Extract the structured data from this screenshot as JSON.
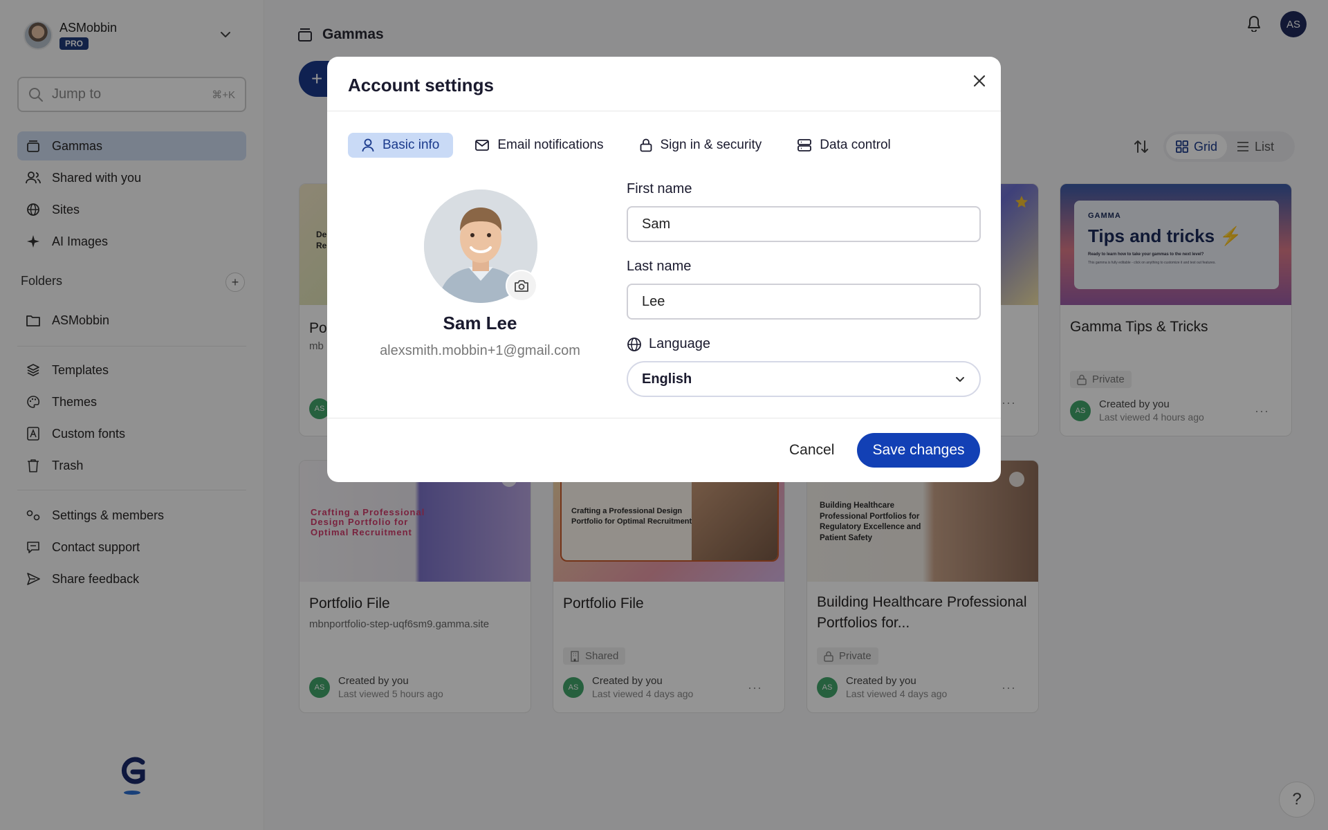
{
  "sidebar": {
    "user_name": "ASMobbin",
    "plan_badge": "PRO",
    "search": {
      "placeholder": "Jump to",
      "shortcut": "⌘+K"
    },
    "nav_primary": [
      {
        "label": "Gammas",
        "icon": "deck-icon",
        "active": true
      },
      {
        "label": "Shared with you",
        "icon": "users-icon"
      },
      {
        "label": "Sites",
        "icon": "globe-icon"
      },
      {
        "label": "AI Images",
        "icon": "sparkle-icon"
      }
    ],
    "folders_title": "Folders",
    "folders": [
      {
        "label": "ASMobbin",
        "icon": "folder-icon"
      }
    ],
    "nav_secondary": [
      {
        "label": "Templates",
        "icon": "layers-icon"
      },
      {
        "label": "Themes",
        "icon": "palette-icon"
      },
      {
        "label": "Custom fonts",
        "icon": "font-icon"
      },
      {
        "label": "Trash",
        "icon": "trash-icon"
      }
    ],
    "nav_tertiary": [
      {
        "label": "Settings & members",
        "icon": "settings-icon"
      },
      {
        "label": "Contact support",
        "icon": "chat-icon"
      },
      {
        "label": "Share feedback",
        "icon": "send-icon"
      }
    ]
  },
  "header": {
    "title": "Gammas",
    "avatar_initials": "AS",
    "view_toggle": {
      "grid": "Grid",
      "list": "List",
      "selected": "Grid"
    }
  },
  "cards": [
    {
      "title": "Po",
      "subtitle": "mb",
      "thumb_lines": [
        "De",
        "Re"
      ]
    },
    {
      "title": "",
      "subtitle": ""
    },
    {
      "title": "Gamma Tips & Tricks",
      "tag": "Private",
      "created": "Created by you",
      "viewed": "Last viewed 4 hours ago",
      "avatar": "AS",
      "thumb": {
        "brand": "GAMMA",
        "headline": "Tips and tricks ⚡",
        "line1": "Ready to learn how to take your gammas to the next level?",
        "line2": "This gamma is fully editable - click on anything to customize it and test out features."
      }
    },
    {
      "title": "Portfolio File",
      "subtitle": "mbnportfolio-step-uqf6sm9.gamma.site",
      "created": "Created by you",
      "viewed": "Last viewed 5 hours ago",
      "avatar": "AS",
      "thumb_text": "Crafting a Professional Design Portfolio for Optimal Recruitment"
    },
    {
      "title": "Portfolio File",
      "tag": "Shared",
      "created": "Created by you",
      "viewed": "Last viewed 4 days ago",
      "avatar": "AS",
      "thumb_text": "Crafting a Professional Design Portfolio for Optimal Recruitment"
    },
    {
      "title": "Building Healthcare Professional Portfolios for...",
      "tag": "Private",
      "created": "Created by you",
      "viewed": "Last viewed 4 days ago",
      "avatar": "AS",
      "thumb_text": "Building Healthcare Professional Portfolios for Regulatory Excellence and Patient Safety"
    }
  ],
  "card_menu_glyph": "···",
  "help_glyph": "?",
  "modal": {
    "title": "Account settings",
    "tabs": [
      {
        "label": "Basic info",
        "icon": "user-icon",
        "active": true
      },
      {
        "label": "Email notifications",
        "icon": "mail-icon"
      },
      {
        "label": "Sign in & security",
        "icon": "lock-icon"
      },
      {
        "label": "Data control",
        "icon": "database-icon"
      }
    ],
    "profile": {
      "name": "Sam Lee",
      "email": "alexsmith.mobbin+1@gmail.com"
    },
    "first_name": {
      "label": "First name",
      "value": "Sam"
    },
    "last_name": {
      "label": "Last name",
      "value": "Lee"
    },
    "language": {
      "label": "Language",
      "value": "English"
    },
    "cancel_label": "Cancel",
    "save_label": "Save changes"
  }
}
